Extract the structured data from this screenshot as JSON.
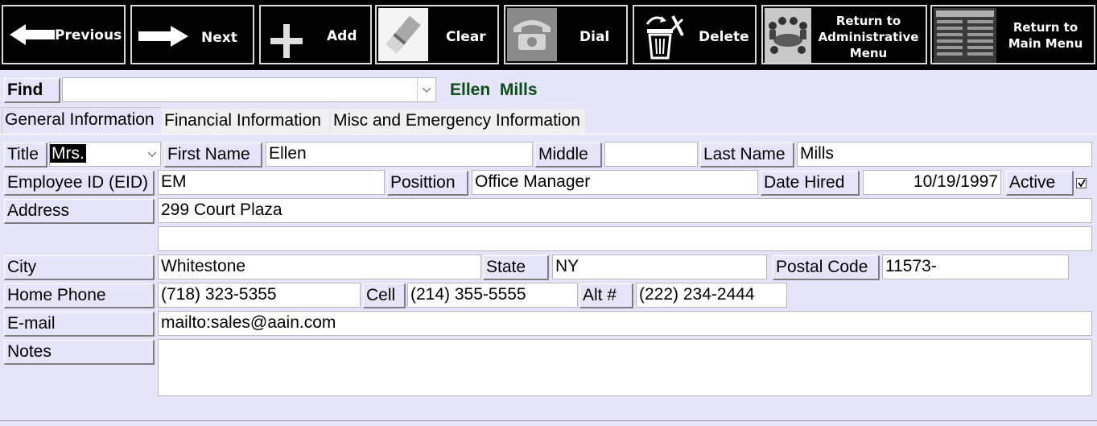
{
  "toolbar": {
    "previous": "Previous",
    "next": "Next",
    "add": "Add",
    "clear": "Clear",
    "dial": "Dial",
    "delete": "Delete",
    "return_admin": "Return to\nAdministrative\nMenu",
    "return_main": "Return to\nMain Menu"
  },
  "find": {
    "label": "Find",
    "value": "",
    "current_name": "Ellen  Mills"
  },
  "tabs": [
    {
      "label": "General Information",
      "active": true
    },
    {
      "label": "Financial Information",
      "active": false
    },
    {
      "label": "Misc and Emergency Information",
      "active": false
    }
  ],
  "labels": {
    "title": "Title",
    "first_name": "First Name",
    "middle": "Middle",
    "last_name": "Last Name",
    "eid": "Employee ID (EID)",
    "position": "Posittion",
    "date_hired": "Date Hired",
    "active": "Active",
    "address": "Address",
    "city": "City",
    "state": "State",
    "postal_code": "Postal Code",
    "home_phone": "Home Phone",
    "cell": "Cell",
    "alt": "Alt #",
    "email": "E-mail",
    "notes": "Notes"
  },
  "values": {
    "title": "Mrs.",
    "first_name": "Ellen",
    "middle": "",
    "last_name": "Mills",
    "eid": "EM",
    "position": "Office Manager",
    "date_hired": "10/19/1997",
    "active": true,
    "address1": "299 Court Plaza",
    "address2": "",
    "city": "Whitestone",
    "state": "NY",
    "postal_code": "11573-",
    "home_phone": "(718) 323-5355",
    "cell": "(214) 355-5555",
    "alt": "(222) 234-2444",
    "email": "mailto:sales@aain.com",
    "notes": ""
  },
  "colors": {
    "background": "#e6e4f8",
    "name_green": "#0d4d1a",
    "toolbar": "#000000"
  }
}
